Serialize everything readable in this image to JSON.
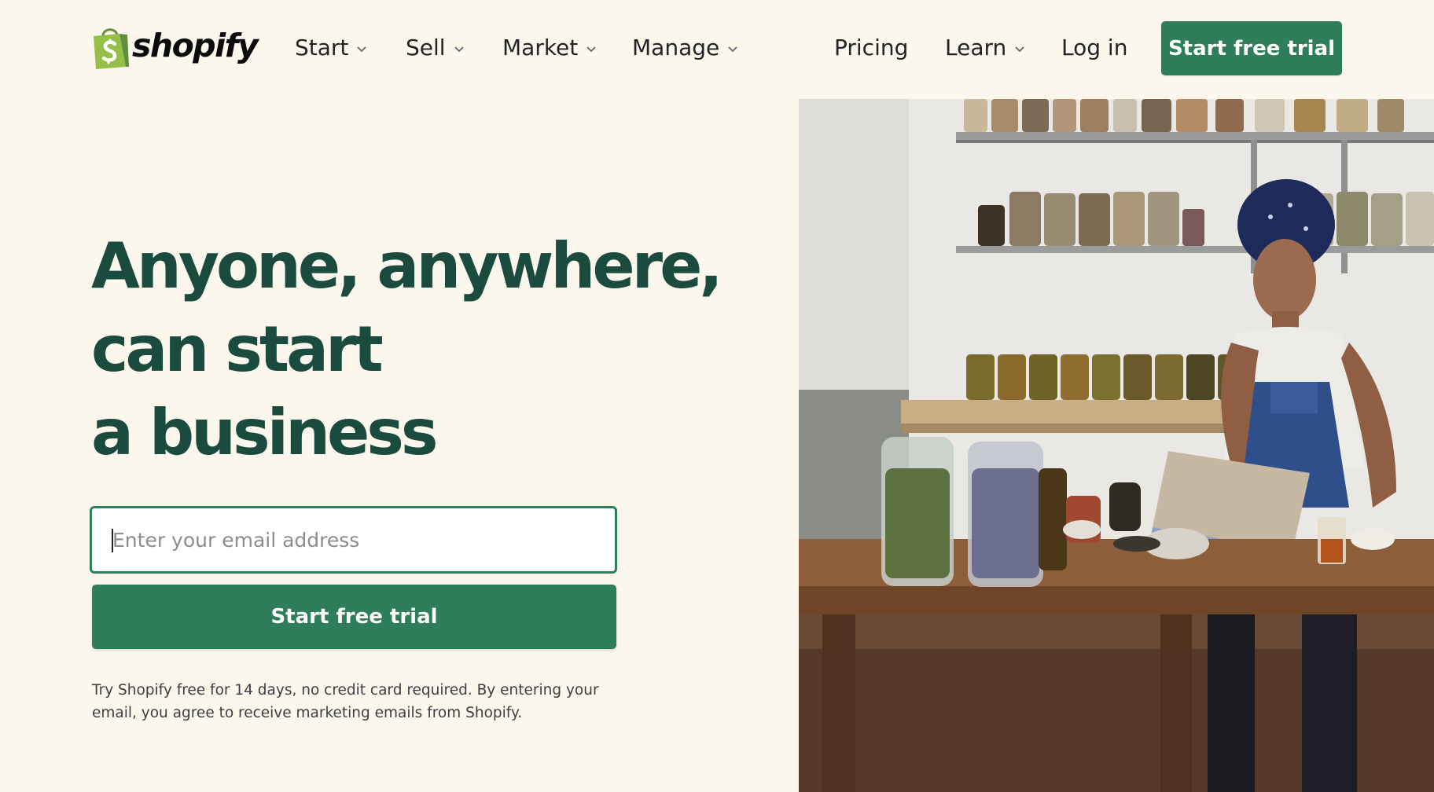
{
  "brand": {
    "name": "shopify",
    "logo_icon": "shopping-bag-icon",
    "colors": {
      "primary": "#2e7d5b",
      "heading": "#1a4b3e",
      "background": "#fbf7ed",
      "logo_green": "#95bf47"
    }
  },
  "nav": {
    "items": [
      {
        "label": "Start",
        "has_dropdown": true
      },
      {
        "label": "Sell",
        "has_dropdown": true
      },
      {
        "label": "Market",
        "has_dropdown": true
      },
      {
        "label": "Manage",
        "has_dropdown": true
      }
    ],
    "right_items": [
      {
        "label": "Pricing",
        "has_dropdown": false
      },
      {
        "label": "Learn",
        "has_dropdown": true
      },
      {
        "label": "Log in",
        "has_dropdown": false
      }
    ],
    "cta_label": "Start free trial"
  },
  "hero": {
    "headline_lines": [
      "Anyone, anywhere,",
      "can start",
      "a business"
    ],
    "email_placeholder": "Enter your email address",
    "email_value": "",
    "cta_label": "Start free trial",
    "disclaimer": "Try Shopify free for 14 days, no credit card required. By entering your email, you agree to receive marketing emails from Shopify."
  }
}
